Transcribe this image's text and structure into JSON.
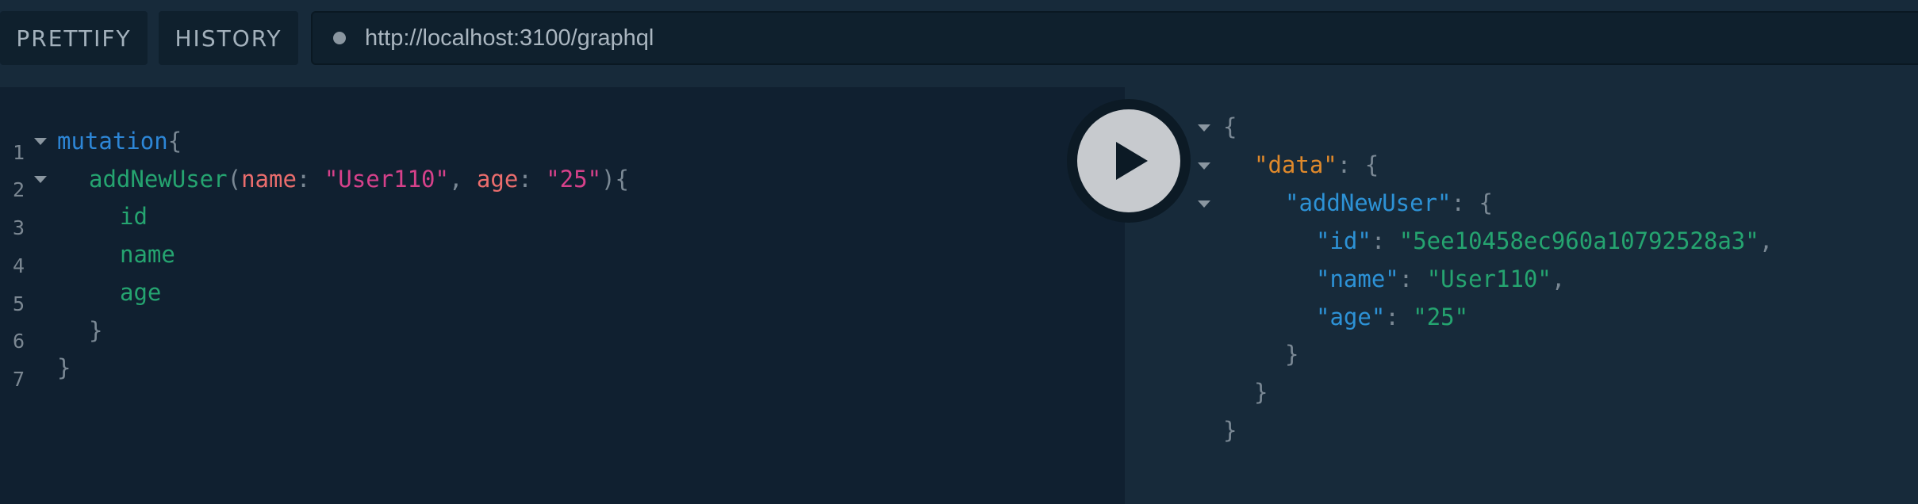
{
  "toolbar": {
    "prettify_label": "PRETTIFY",
    "history_label": "HISTORY",
    "endpoint_url": "http://localhost:3100/graphql"
  },
  "editor": {
    "line_numbers": [
      "1",
      "2",
      "3",
      "4",
      "5",
      "6",
      "7"
    ],
    "l1_keyword": "mutation",
    "l1_brace": "{",
    "l2_field": "addNewUser",
    "l2_open_paren": "(",
    "l2_arg1": "name",
    "l2_colon1": ": ",
    "l2_val1": "\"User110\"",
    "l2_comma": ", ",
    "l2_arg2": "age",
    "l2_colon2": ": ",
    "l2_val2": "\"25\"",
    "l2_close_paren": ")",
    "l2_brace": "{",
    "l3_field": "id",
    "l4_field": "name",
    "l5_field": "age",
    "l6_brace": "}",
    "l7_brace": "}"
  },
  "result": {
    "open_root": "{",
    "data_key": "\"data\"",
    "sep": ": ",
    "open_data": "{",
    "addNewUser_key": "\"addNewUser\"",
    "open_user": "{",
    "id_key": "\"id\"",
    "id_value": "\"5ee10458ec960a10792528a3\"",
    "comma": ",",
    "name_key": "\"name\"",
    "name_value": "\"User110\"",
    "age_key": "\"age\"",
    "age_value": "\"25\"",
    "close_user": "}",
    "close_data": "}",
    "close_root": "}"
  },
  "colors": {
    "keyword": "#2d86d6",
    "field": "#25a470",
    "argument": "#eb6d6d",
    "string": "#d6418a",
    "data_key": "#e0892b"
  },
  "icons": {
    "execute": "play-icon",
    "status": "dot-icon",
    "fold": "triangle-down-icon"
  }
}
